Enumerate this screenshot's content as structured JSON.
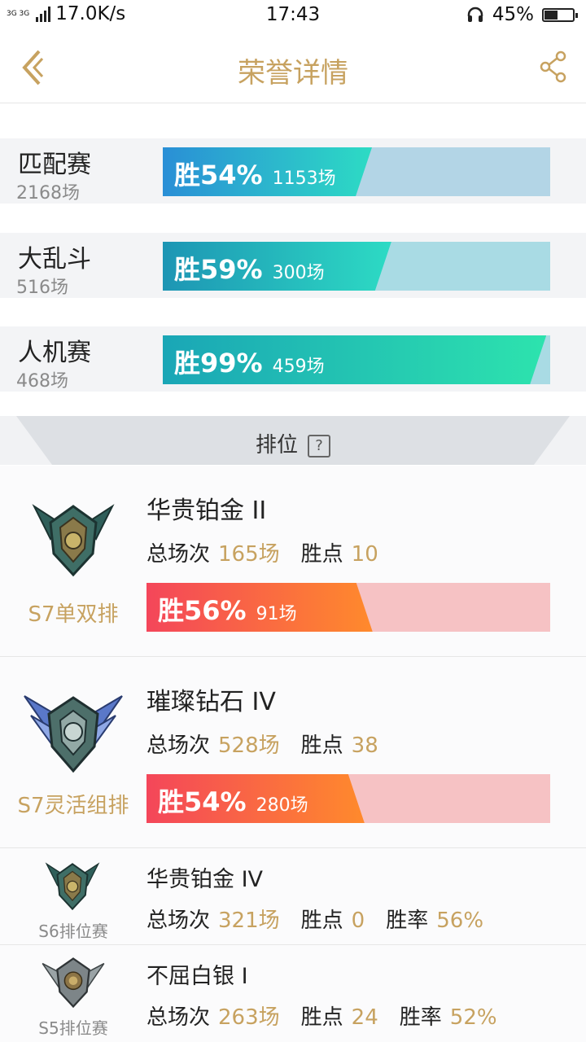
{
  "status": {
    "network": "3G 3G",
    "speed": "17.0K/s",
    "time": "17:43",
    "battery": "45%",
    "battery_level": 0.45
  },
  "header": {
    "title": "荣誉详情"
  },
  "modes": [
    {
      "name": "匹配赛",
      "total": "2168场",
      "win": "胜54%",
      "games": "1153场",
      "win_fraction": 0.54,
      "bg": "#b3d5e6",
      "fill_from": "#2a8fd6",
      "fill_to": "#2ddbc4"
    },
    {
      "name": "大乱斗",
      "total": "516场",
      "win": "胜59%",
      "games": "300场",
      "win_fraction": 0.59,
      "bg": "#a9dbe4",
      "fill_from": "#1d95b4",
      "fill_to": "#2ddbc4"
    },
    {
      "name": "人机赛",
      "total": "468场",
      "win": "胜99%",
      "games": "459场",
      "win_fraction": 0.99,
      "bg": "#a9dbe4",
      "fill_from": "#1aa6b6",
      "fill_to": "#2de3ae"
    }
  ],
  "ranked": {
    "title": "排位",
    "help": "?",
    "current": [
      {
        "season": "S7单双排",
        "tier": "华贵铂金 II",
        "games_label": "总场次",
        "games": "165场",
        "points_label": "胜点",
        "points": "10",
        "win": "胜56%",
        "win_games": "91场",
        "win_fraction": 0.56
      },
      {
        "season": "S7灵活组排",
        "tier": "璀璨钻石 IV",
        "games_label": "总场次",
        "games": "528场",
        "points_label": "胜点",
        "points": "38",
        "win": "胜54%",
        "win_games": "280场",
        "win_fraction": 0.54
      }
    ],
    "history": [
      {
        "season": "S6排位赛",
        "tier": "华贵铂金 IV",
        "games_label": "总场次",
        "games": "321场",
        "points_label": "胜点",
        "points": "0",
        "rate_label": "胜率",
        "rate": "56%"
      },
      {
        "season": "S5排位赛",
        "tier": "不屈白银 I",
        "games_label": "总场次",
        "games": "263场",
        "points_label": "胜点",
        "points": "24",
        "rate_label": "胜率",
        "rate": "52%"
      }
    ]
  },
  "colors": {
    "accent": "#c7a260",
    "ranked_from": "#f4465a",
    "ranked_to": "#ff8a2c",
    "ranked_bg": "#f6c2c4"
  }
}
